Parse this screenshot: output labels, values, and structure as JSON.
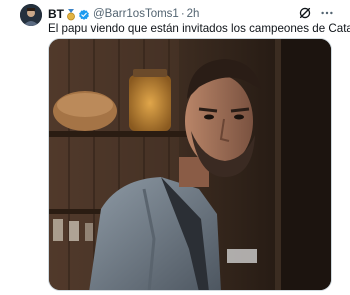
{
  "tweet": {
    "display_name": "BT",
    "handle": "@Barr1osToms1",
    "separator": "·",
    "time": "2h",
    "text": "El papu viendo que están invitados los campeones de Catar",
    "media_icon": "person-peeking-photo"
  },
  "icons": {
    "medal": "medal-icon",
    "verified": "verified-badge-icon",
    "grok": "grok-icon",
    "more": "more-options-icon"
  },
  "colors": {
    "verified": "#1d9bf0",
    "secondary_text": "#536471"
  }
}
